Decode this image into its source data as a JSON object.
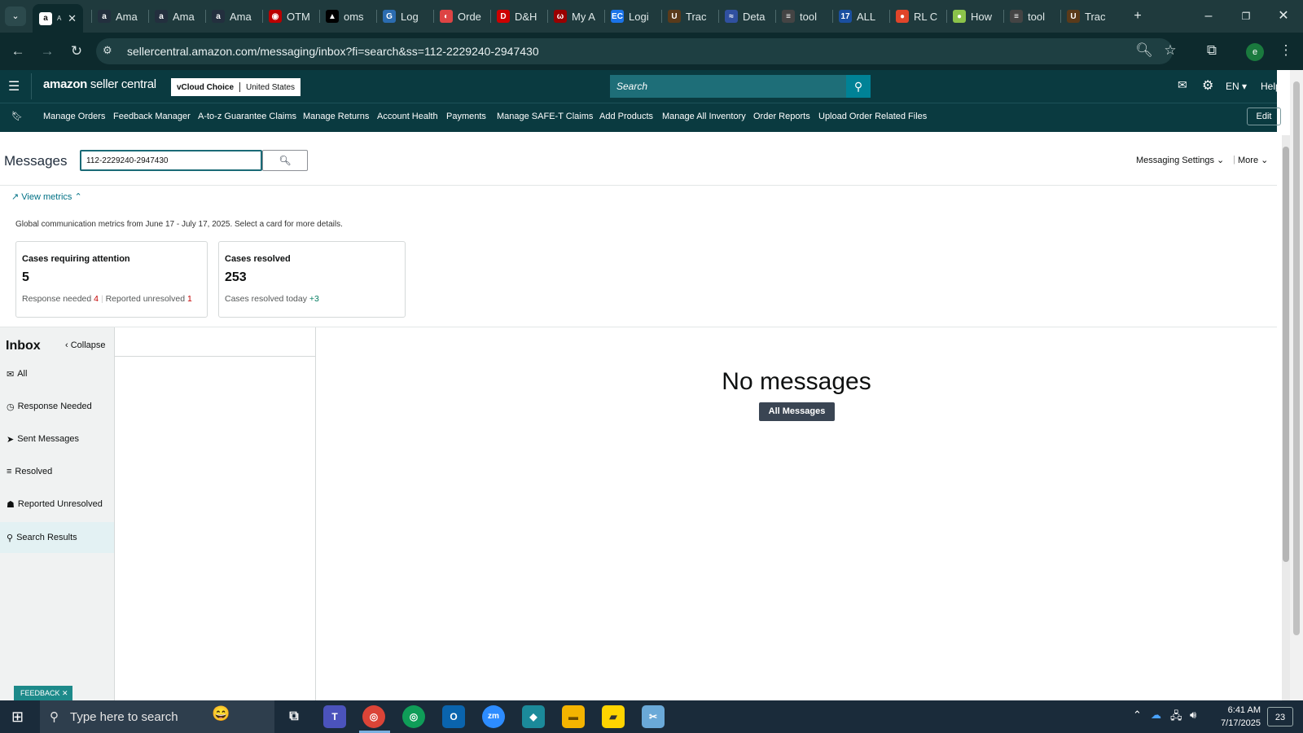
{
  "browser": {
    "tabs": [
      {
        "label": "A",
        "icon": "amazon-a-icon"
      },
      {
        "label": "Ama",
        "icon": "amazon-a-icon"
      },
      {
        "label": "Ama",
        "icon": "amazon-a-icon"
      },
      {
        "label": "Ama",
        "icon": "amazon-a-icon"
      },
      {
        "label": "OTM",
        "icon": "otm-icon"
      },
      {
        "label": "oms",
        "icon": "oms-icon"
      },
      {
        "label": "Log",
        "icon": "login-icon"
      },
      {
        "label": "Orde",
        "icon": "order-icon"
      },
      {
        "label": "D&H",
        "icon": "dh-icon"
      },
      {
        "label": "My A",
        "icon": "myaccount-icon"
      },
      {
        "label": "Logi",
        "icon": "ec-icon"
      },
      {
        "label": "Trac",
        "icon": "ups-icon"
      },
      {
        "label": "Deta",
        "icon": "details-icon"
      },
      {
        "label": "tool",
        "icon": "tool-icon"
      },
      {
        "label": "ALL",
        "icon": "17track-icon"
      },
      {
        "label": "RL C",
        "icon": "rl-icon"
      },
      {
        "label": "How",
        "icon": "how-icon"
      },
      {
        "label": "tool",
        "icon": "tool-icon"
      },
      {
        "label": "Trac",
        "icon": "ups-icon"
      }
    ],
    "url": "sellercentral.amazon.com/messaging/inbox?fi=search&ss=112-2229240-2947430",
    "profile_initial": "e"
  },
  "header": {
    "logo_bold": "amazon",
    "logo_rest": " seller central",
    "account_name": "vCloud Choice",
    "marketplace": "United States",
    "search_placeholder": "Search",
    "language": "EN",
    "help": "Help"
  },
  "nav": {
    "links": [
      "Manage Orders",
      "Feedback Manager",
      "A-to-z Guarantee Claims",
      "Manage Returns",
      "Account Health",
      "Payments",
      "Manage SAFE-T Claims",
      "Add Products",
      "Manage All Inventory",
      "Order Reports",
      "Upload Order Related Files"
    ],
    "edit": "Edit"
  },
  "messages": {
    "title": "Messages",
    "search_value": "112-2229240-2947430",
    "settings": "Messaging Settings",
    "more": "More",
    "view_metrics": "View metrics",
    "metrics_desc": "Global communication metrics from June 17 - July 17, 2025. Select a card for more details.",
    "cards": [
      {
        "title": "Cases requiring attention",
        "value": "5",
        "sub1": "Response needed",
        "sub1_val": "4",
        "sub2": "Reported unresolved",
        "sub2_val": "1"
      },
      {
        "title": "Cases resolved",
        "value": "253",
        "sub1": "Cases resolved today",
        "sub1_val": "+3"
      }
    ]
  },
  "inbox": {
    "title": "Inbox",
    "collapse": "Collapse",
    "items": [
      {
        "label": "All",
        "icon": "mail-icon"
      },
      {
        "label": "Response Needed",
        "icon": "clock-icon"
      },
      {
        "label": "Sent Messages",
        "icon": "send-icon"
      },
      {
        "label": "Resolved",
        "icon": "resolved-list-icon"
      },
      {
        "label": "Reported Unresolved",
        "icon": "report-user-icon"
      },
      {
        "label": "Search Results",
        "icon": "search-icon"
      }
    ],
    "empty_title": "No messages",
    "all_messages_button": "All Messages"
  },
  "feedback": "FEEDBACK",
  "taskbar": {
    "search_placeholder": "Type here to search",
    "time": "6:41 AM",
    "date": "7/17/2025",
    "notif_count": "23"
  }
}
